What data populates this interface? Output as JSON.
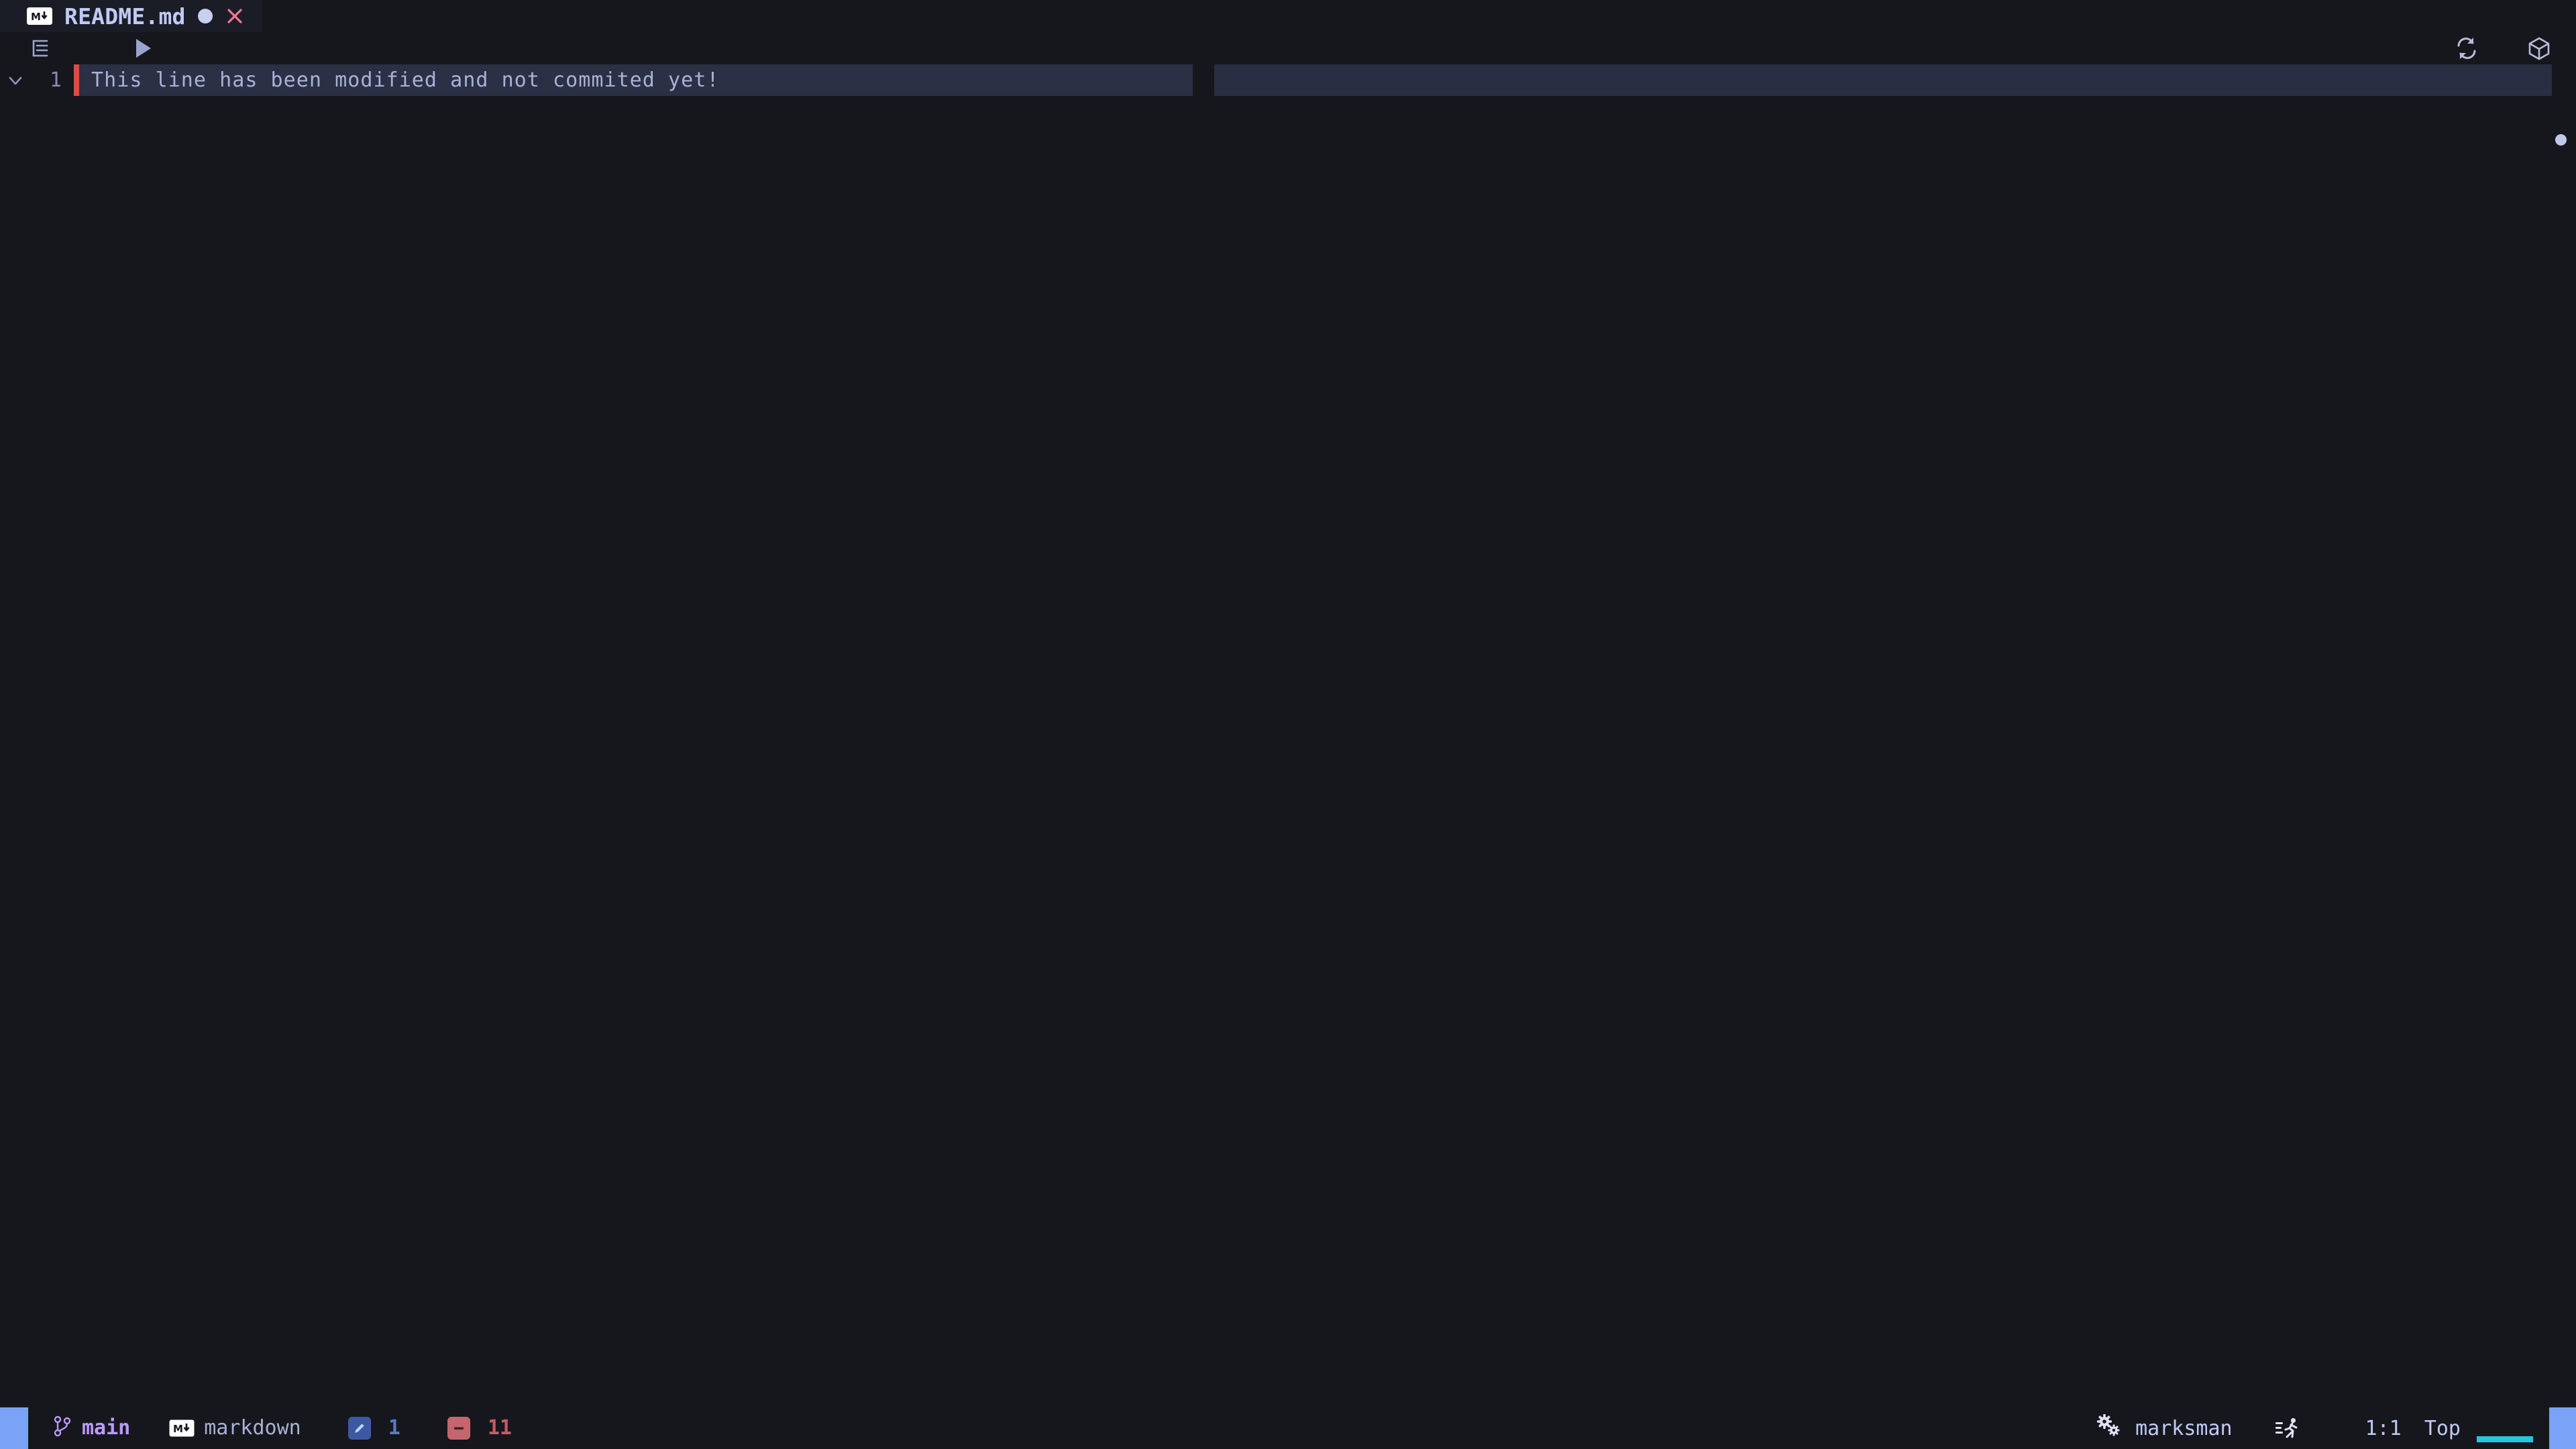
{
  "window": {
    "background": "#16171d",
    "accent": "#7aa2f7"
  },
  "tabbar": {
    "tabs": [
      {
        "filetype_icon": "markdown-icon",
        "title": "README.md",
        "modified_indicator": "●",
        "close_icon": "close-icon",
        "active": true
      }
    ]
  },
  "breadcrumb_bar": {
    "left_icons": [
      {
        "name": "outline-icon"
      },
      {
        "name": "run-play-icon"
      }
    ],
    "right_icons": [
      {
        "name": "refresh-icon"
      },
      {
        "name": "package-cube-icon"
      }
    ]
  },
  "editor": {
    "lines": [
      {
        "number": "1",
        "fold_icon": "chevron-down-icon",
        "git_status": "modified",
        "git_color": "#db4b4b",
        "text": "This line has been modified and not commited yet!"
      }
    ],
    "selection_color": "#2b3045",
    "current_line_color": "#292e42",
    "overview_ruler_marks": [
      {
        "name": "cursor-mark",
        "color": "#c0c8ea"
      }
    ]
  },
  "statusbar": {
    "mode_block_color": "#7aa2f7",
    "git": {
      "icon": "git-branch-icon",
      "branch": "main",
      "color": "#bb9af7"
    },
    "language": {
      "icon": "markdown-icon",
      "label": "markdown"
    },
    "diagnostics": [
      {
        "icon": "pencil-hint-icon",
        "count": "1",
        "badge_color": "#3d59a1",
        "text_color": "#5a7bc4"
      },
      {
        "icon": "minus-error-icon",
        "count": "11",
        "badge_color": "#c4666e",
        "text_color": "#c55c66"
      }
    ],
    "lsp": {
      "icon": "gears-icon",
      "label": "marksman"
    },
    "runner_icon": "running-person-icon",
    "cursor_position": "1:1",
    "scroll_position": "Top",
    "progress_color": "#2ac3de",
    "end_block_color": "#7aa2f7"
  }
}
